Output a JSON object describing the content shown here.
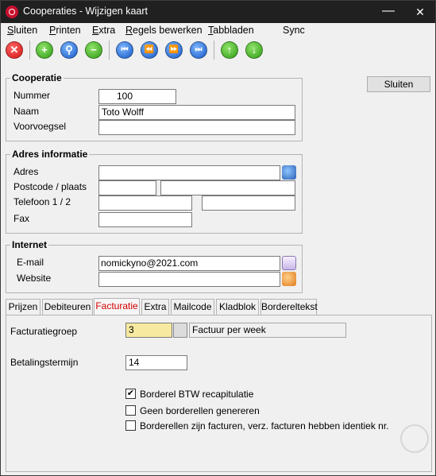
{
  "window": {
    "title": "Cooperaties - Wijzigen kaart",
    "min_glyph": "—",
    "close_glyph": "✕"
  },
  "menu": [
    {
      "ul": "S",
      "rest": "luiten"
    },
    {
      "ul": "P",
      "rest": "rinten"
    },
    {
      "ul": "E",
      "rest": "xtra"
    },
    {
      "ul": "R",
      "rest": "egels bewerken"
    },
    {
      "ul": "T",
      "rest": "abbladen"
    },
    {
      "ul": "",
      "rest": "Sync"
    }
  ],
  "toolbar": {
    "close_glyph": "✕",
    "add_glyph": "+",
    "search_glyph": "⚲",
    "remove_glyph": "−",
    "first_glyph": "⏮",
    "prev_glyph": "⏪",
    "next_glyph": "⏩",
    "last_glyph": "⏭",
    "up_glyph": "↑",
    "down_glyph": "↓",
    "icons": [
      "cancel-icon",
      "add-icon",
      "search-icon",
      "remove-icon",
      "first-record-icon",
      "previous-record-icon",
      "next-record-icon",
      "last-record-icon",
      "move-up-icon",
      "move-down-icon"
    ]
  },
  "cooperatie": {
    "legend": "Cooperatie",
    "nummer_label": "Nummer",
    "nummer": "100",
    "naam_label": "Naam",
    "naam": "Toto Wolff",
    "voorvoegsel_label": "Voorvoegsel",
    "voorvoegsel": ""
  },
  "adres": {
    "legend": "Adres informatie",
    "adres_label": "Adres",
    "adres": "",
    "postcode_label": "Postcode / plaats",
    "postcode": "",
    "plaats": "",
    "telefoon_label": "Telefoon 1 / 2",
    "telefoon1": "",
    "telefoon2": "",
    "fax_label": "Fax",
    "fax": ""
  },
  "internet": {
    "legend": "Internet",
    "email_label": "E-mail",
    "email": "nomickyno@2021.com",
    "website_label": "Website",
    "website": ""
  },
  "buttons": {
    "sluiten": "Sluiten"
  },
  "tabs": [
    "Prijzen",
    "Debiteuren",
    "Facturatie",
    "Extra",
    "Mailcode",
    "Kladblok",
    "Bordereltekst"
  ],
  "active_tab": "Facturatie",
  "facturatie": {
    "groep_label": "Facturatiegroep",
    "groep_code": "3",
    "groep_omschrijving": "Factuur per week",
    "termijn_label": "Betalingstermijn",
    "termijn": "14",
    "chk1_label": "Borderel BTW recapitulatie",
    "chk1": true,
    "chk1_mark": "✔",
    "chk2_label": "Geen borderellen genereren",
    "chk2": false,
    "chk3_label": "Borderellen zijn facturen, verz. facturen hebben identiek nr.",
    "chk3": false
  },
  "colors": {
    "titlebar": "#202020",
    "window_bg": "#f0f0f0",
    "active_tab": "#d40000",
    "lookup_field": "#f7e9a0"
  }
}
